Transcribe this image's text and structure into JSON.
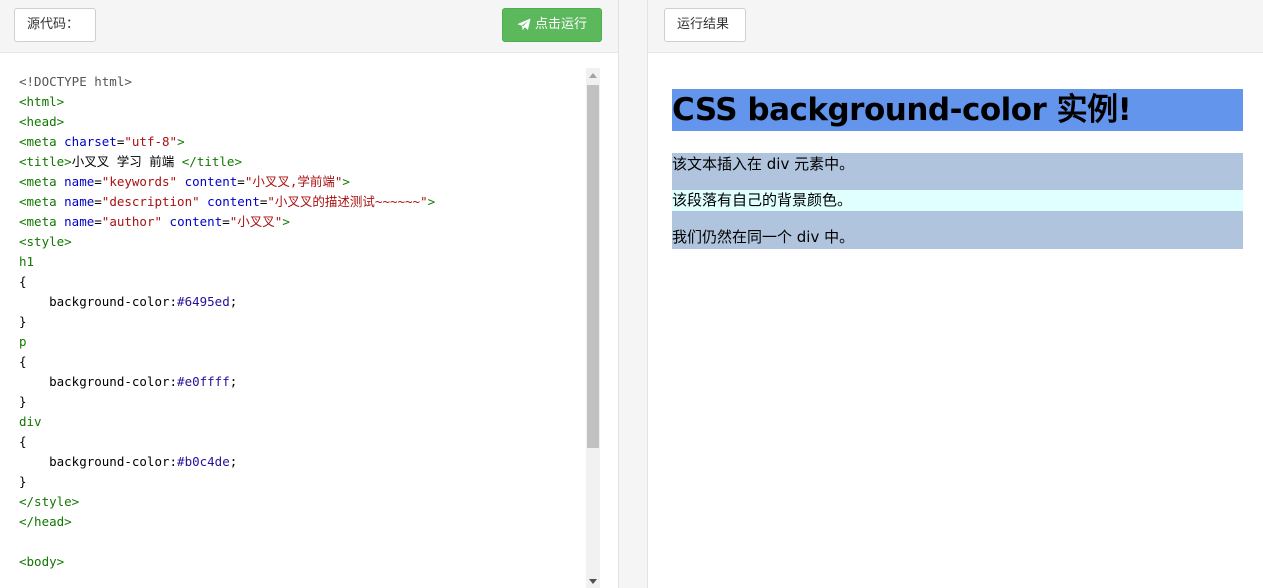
{
  "left": {
    "source_button": "源代码：",
    "run_button": "点击运行",
    "code_lines": [
      [
        {
          "c": "m",
          "t": "<!DOCTYPE html>"
        }
      ],
      [
        {
          "c": "t",
          "t": "<html>"
        }
      ],
      [
        {
          "c": "t",
          "t": "<head>"
        }
      ],
      [
        {
          "c": "t",
          "t": "<meta "
        },
        {
          "c": "a",
          "t": "charset"
        },
        {
          "c": "p",
          "t": "="
        },
        {
          "c": "s",
          "t": "\"utf-8\""
        },
        {
          "c": "t",
          "t": ">"
        }
      ],
      [
        {
          "c": "t",
          "t": "<title>"
        },
        {
          "c": "p",
          "t": "小叉叉 学习 前端 "
        },
        {
          "c": "t",
          "t": "</title>"
        }
      ],
      [
        {
          "c": "t",
          "t": "<meta "
        },
        {
          "c": "a",
          "t": "name"
        },
        {
          "c": "p",
          "t": "="
        },
        {
          "c": "s",
          "t": "\"keywords\""
        },
        {
          "c": "p",
          "t": " "
        },
        {
          "c": "a",
          "t": "content"
        },
        {
          "c": "p",
          "t": "="
        },
        {
          "c": "s",
          "t": "\"小叉叉,学前端\""
        },
        {
          "c": "t",
          "t": ">"
        }
      ],
      [
        {
          "c": "t",
          "t": "<meta "
        },
        {
          "c": "a",
          "t": "name"
        },
        {
          "c": "p",
          "t": "="
        },
        {
          "c": "s",
          "t": "\"description\""
        },
        {
          "c": "p",
          "t": " "
        },
        {
          "c": "a",
          "t": "content"
        },
        {
          "c": "p",
          "t": "="
        },
        {
          "c": "s",
          "t": "\"小叉叉的描述测试~~~~~~\""
        },
        {
          "c": "t",
          "t": ">"
        }
      ],
      [
        {
          "c": "t",
          "t": "<meta "
        },
        {
          "c": "a",
          "t": "name"
        },
        {
          "c": "p",
          "t": "="
        },
        {
          "c": "s",
          "t": "\"author\""
        },
        {
          "c": "p",
          "t": " "
        },
        {
          "c": "a",
          "t": "content"
        },
        {
          "c": "p",
          "t": "="
        },
        {
          "c": "s",
          "t": "\"小叉叉\""
        },
        {
          "c": "t",
          "t": ">"
        }
      ],
      [
        {
          "c": "t",
          "t": "<style>"
        }
      ],
      [
        {
          "c": "t",
          "t": "h1"
        }
      ],
      [
        {
          "c": "p",
          "t": "{"
        }
      ],
      [
        {
          "c": "p",
          "t": "    background-color:"
        },
        {
          "c": "k",
          "t": "#6495ed"
        },
        {
          "c": "p",
          "t": ";"
        }
      ],
      [
        {
          "c": "p",
          "t": "}"
        }
      ],
      [
        {
          "c": "t",
          "t": "p"
        }
      ],
      [
        {
          "c": "p",
          "t": "{"
        }
      ],
      [
        {
          "c": "p",
          "t": "    background-color:"
        },
        {
          "c": "k",
          "t": "#e0ffff"
        },
        {
          "c": "p",
          "t": ";"
        }
      ],
      [
        {
          "c": "p",
          "t": "}"
        }
      ],
      [
        {
          "c": "t",
          "t": "div"
        }
      ],
      [
        {
          "c": "p",
          "t": "{"
        }
      ],
      [
        {
          "c": "p",
          "t": "    background-color:"
        },
        {
          "c": "k",
          "t": "#b0c4de"
        },
        {
          "c": "p",
          "t": ";"
        }
      ],
      [
        {
          "c": "p",
          "t": "}"
        }
      ],
      [
        {
          "c": "t",
          "t": "</style>"
        }
      ],
      [
        {
          "c": "t",
          "t": "</head>"
        }
      ],
      [
        {
          "c": "p",
          "t": ""
        }
      ],
      [
        {
          "c": "t",
          "t": "<body>"
        }
      ]
    ]
  },
  "right": {
    "result_button": "运行结果",
    "heading": "CSS background-color 实例!",
    "div_text": "该文本插入在 div 元素中。",
    "p_text": "该段落有自己的背景颜色。",
    "div_text_2": "我们仍然在同一个 div 中。"
  },
  "colors": {
    "run_button_bg": "#5cb85c",
    "h1_bg": "#6495ed",
    "p_bg": "#e0ffff",
    "div_bg": "#b0c4de"
  },
  "icons": {
    "run_icon": "paper-plane-icon"
  }
}
